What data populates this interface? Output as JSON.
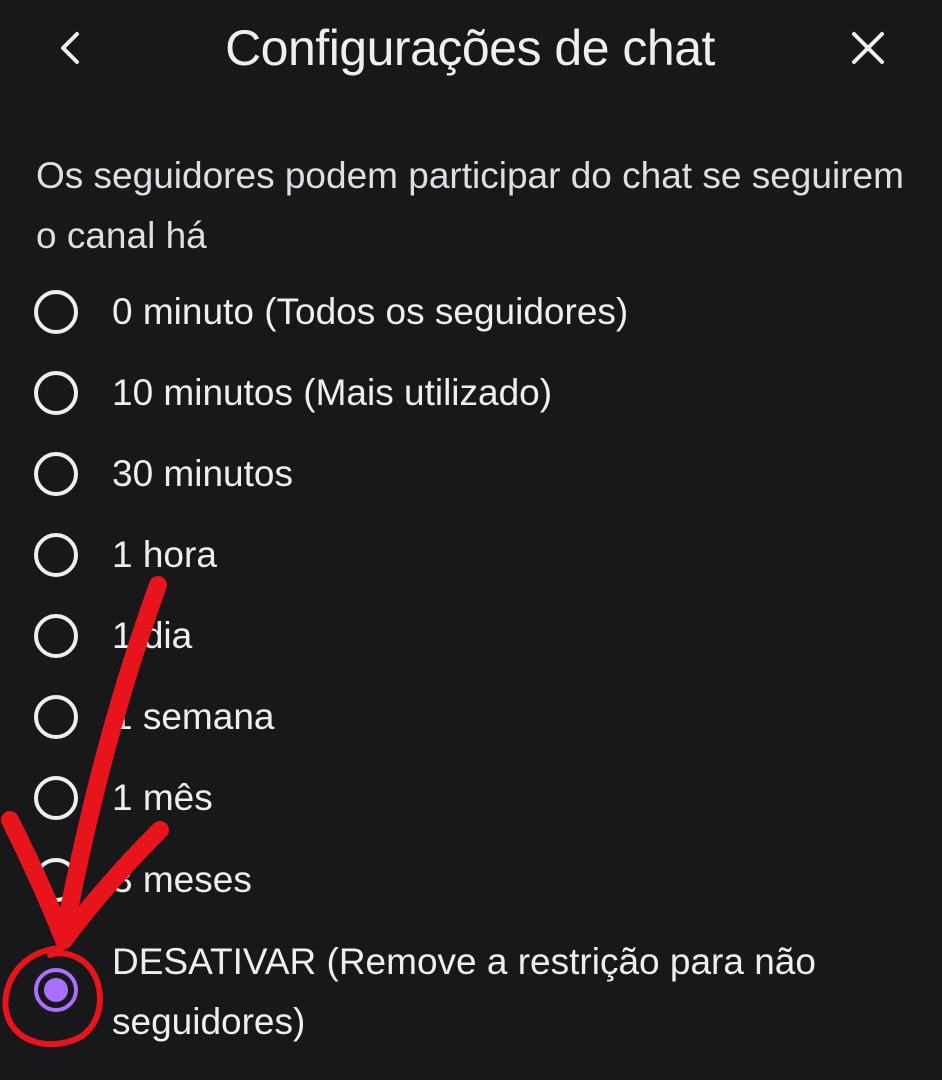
{
  "header": {
    "title": "Configurações de chat",
    "back_icon": "chevron-left-icon",
    "close_icon": "close-icon"
  },
  "description": "Os seguidores podem participar do chat se seguirem o canal há",
  "options": [
    {
      "label": "0 minuto (Todos os seguidores)",
      "checked": false
    },
    {
      "label": "10 minutos (Mais utilizado)",
      "checked": false
    },
    {
      "label": "30 minutos",
      "checked": false
    },
    {
      "label": "1 hora",
      "checked": false
    },
    {
      "label": "1 dia",
      "checked": false
    },
    {
      "label": "1 semana",
      "checked": false
    },
    {
      "label": "1 mês",
      "checked": false
    },
    {
      "label": "3 meses",
      "checked": false
    },
    {
      "label": "DESATIVAR (Remove a restrição para não seguidores)",
      "checked": true
    }
  ],
  "colors": {
    "background": "#18181b",
    "text": "#efeff1",
    "accent": "#a970ff",
    "annotation": "#e8141c"
  }
}
